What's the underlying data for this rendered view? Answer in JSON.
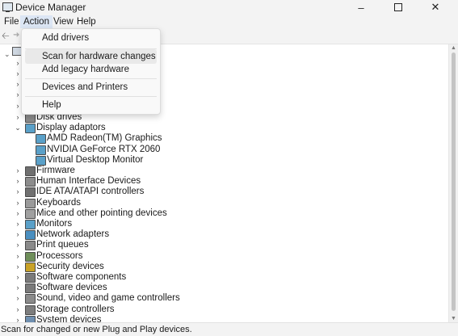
{
  "window": {
    "title": "Device Manager",
    "icon": "device-manager-icon"
  },
  "menu": {
    "file": "File",
    "action": "Action",
    "view": "View",
    "help": "Help"
  },
  "action_menu": {
    "add_drivers": "Add drivers",
    "scan": "Scan for hardware changes",
    "add_legacy": "Add legacy hardware",
    "devices_printers": "Devices and Printers",
    "help": "Help"
  },
  "tree": {
    "items": [
      {
        "label": "Disk drives",
        "expanded": false,
        "icon": "disk-drive-icon",
        "color": "#8a8a8a"
      },
      {
        "label": "Display adaptors",
        "expanded": true,
        "icon": "monitor-icon",
        "color": "#5aa0c8"
      },
      {
        "label": "AMD Radeon(TM) Graphics",
        "child": true,
        "icon": "monitor-icon",
        "color": "#5aa0c8"
      },
      {
        "label": "NVIDIA GeForce RTX 2060",
        "child": true,
        "icon": "monitor-icon",
        "color": "#5aa0c8"
      },
      {
        "label": "Virtual Desktop Monitor",
        "child": true,
        "icon": "monitor-icon",
        "color": "#5aa0c8"
      },
      {
        "label": "Firmware",
        "expanded": false,
        "icon": "firmware-icon",
        "color": "#6f6f6f"
      },
      {
        "label": "Human Interface Devices",
        "expanded": false,
        "icon": "hid-icon",
        "color": "#8c8c8c"
      },
      {
        "label": "IDE ATA/ATAPI controllers",
        "expanded": false,
        "icon": "controller-icon",
        "color": "#707070"
      },
      {
        "label": "Keyboards",
        "expanded": false,
        "icon": "keyboard-icon",
        "color": "#9a9a9a"
      },
      {
        "label": "Mice and other pointing devices",
        "expanded": false,
        "icon": "mouse-icon",
        "color": "#a0a0a0"
      },
      {
        "label": "Monitors",
        "expanded": false,
        "icon": "monitor-icon",
        "color": "#5aa0c8"
      },
      {
        "label": "Network adapters",
        "expanded": false,
        "icon": "network-icon",
        "color": "#4a8fc0"
      },
      {
        "label": "Print queues",
        "expanded": false,
        "icon": "printer-icon",
        "color": "#8a8a8a"
      },
      {
        "label": "Processors",
        "expanded": false,
        "icon": "processor-icon",
        "color": "#6f8f5a"
      },
      {
        "label": "Security devices",
        "expanded": false,
        "icon": "security-icon",
        "color": "#c9a227"
      },
      {
        "label": "Software components",
        "expanded": false,
        "icon": "software-component-icon",
        "color": "#7a7a7a"
      },
      {
        "label": "Software devices",
        "expanded": false,
        "icon": "software-device-icon",
        "color": "#7a7a7a"
      },
      {
        "label": "Sound, video and game controllers",
        "expanded": false,
        "icon": "speaker-icon",
        "color": "#8a8a8a"
      },
      {
        "label": "Storage controllers",
        "expanded": false,
        "icon": "storage-icon",
        "color": "#7d7d7d"
      },
      {
        "label": "System devices",
        "expanded": false,
        "icon": "system-icon",
        "color": "#6f8fb0"
      }
    ]
  },
  "status": {
    "text": "Scan for changed or new Plug and Play devices."
  }
}
